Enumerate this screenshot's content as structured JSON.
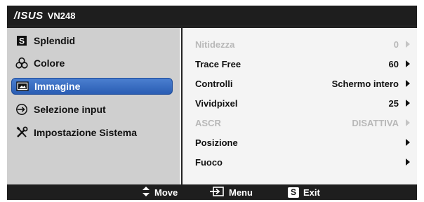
{
  "header": {
    "brand": "/ISUS",
    "model": "VN248"
  },
  "sidebar": {
    "items": [
      {
        "label": "Splendid",
        "icon": "splendid-s-icon"
      },
      {
        "label": "Colore",
        "icon": "color-circles-icon"
      },
      {
        "label": "Immagine",
        "icon": "image-icon",
        "selected": true
      },
      {
        "label": "Selezione input",
        "icon": "input-arrow-icon"
      },
      {
        "label": "Impostazione Sistema",
        "icon": "tools-icon"
      }
    ]
  },
  "content": {
    "rows": [
      {
        "label": "Nitidezza",
        "value": "0",
        "disabled": true,
        "has_arrow": true
      },
      {
        "label": "Trace Free",
        "value": "60",
        "disabled": false,
        "has_arrow": true
      },
      {
        "label": "Controlli",
        "value": "Schermo intero",
        "disabled": false,
        "has_arrow": true
      },
      {
        "label": "Vividpixel",
        "value": "25",
        "disabled": false,
        "has_arrow": true
      },
      {
        "label": "ASCR",
        "value": "DISATTIVA",
        "disabled": true,
        "has_arrow": true
      },
      {
        "label": "Posizione",
        "value": "",
        "disabled": false,
        "has_arrow": true
      },
      {
        "label": "Fuoco",
        "value": "",
        "disabled": false,
        "has_arrow": true
      }
    ]
  },
  "footer": {
    "move_label": "Move",
    "menu_label": "Menu",
    "exit_label": "Exit",
    "exit_badge": "S"
  },
  "colors": {
    "selected_bg": "#3a6dc4",
    "disabled_text": "#b8b8b8",
    "header_bg": "#1e1e1e"
  }
}
